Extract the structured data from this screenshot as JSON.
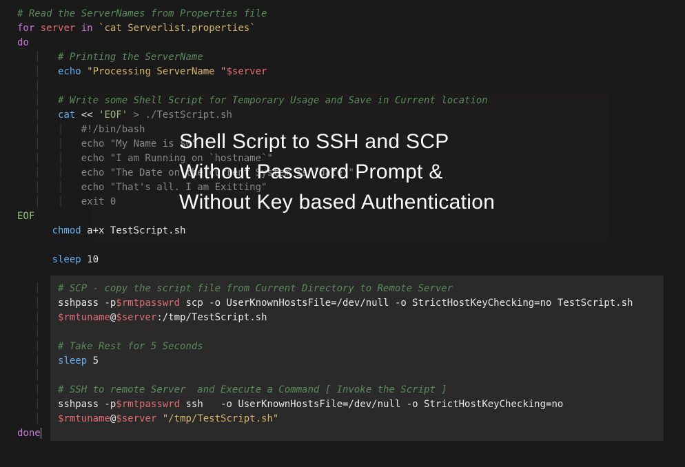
{
  "title": {
    "line1": "Shell Script to SSH and SCP",
    "line2": "Without Password Prompt &",
    "line3": "Without Key based Authentication"
  },
  "code": {
    "l1": "# Read the ServerNames from Properties file",
    "l2_for": "for",
    "l2_var": "server",
    "l2_in": "in",
    "l2_cmd": "`cat Serverlist.properties`",
    "l3": "do",
    "l4": "# Printing the ServerName",
    "l5_cmd": "echo",
    "l5_str": "\"Processing ServerName \"",
    "l5_var": "$server",
    "l6": "",
    "l7": "# Write some Shell Script for Temporary Usage and Save in Current location",
    "l8_cmd": "cat",
    "l8_op": "<<",
    "l8_eof": "'EOF'",
    "l8_redir": "> ./TestScript.sh",
    "l9": "#!/bin/bash",
    "l10": "echo \"My Name is $0\"",
    "l11": "echo \"I am Running on `hostname`\"",
    "l12": "echo \"The Date on the current System is `date`\"",
    "l13": "echo \"That's all. I am Exitting\"",
    "l14": "exit 0",
    "l15": "EOF",
    "l16_cmd": "chmod",
    "l16_arg": "a+x TestScript.sh",
    "l17": "",
    "l18_cmd": "sleep",
    "l18_arg": "10",
    "l19": "",
    "l20": "# SCP - copy the script file from Current Directory to Remote Server",
    "l21_a": "sshpass -p",
    "l21_var": "$rmtpasswrd",
    "l21_b": " scp -o UserKnownHostsFile=/dev/null -o StrictHostKeyChecking=no TestScript.sh",
    "l22_var1": "$rmtuname",
    "l22_at": "@",
    "l22_var2": "$server",
    "l22_b": ":/tmp/TestScript.sh",
    "l23": "",
    "l24": "# Take Rest for 5 Seconds",
    "l25_cmd": "sleep",
    "l25_arg": "5",
    "l26": "",
    "l27": "# SSH to remote Server  and Execute a Command [ Invoke the Script ]",
    "l28_a": "sshpass -p",
    "l28_var": "$rmtpasswrd",
    "l28_b": " ssh   -o UserKnownHostsFile=/dev/null -o StrictHostKeyChecking=no",
    "l29_var1": "$rmtuname",
    "l29_at": "@",
    "l29_var2": "$server",
    "l29_str": " \"/tmp/TestScript.sh\"",
    "l30": "done"
  }
}
